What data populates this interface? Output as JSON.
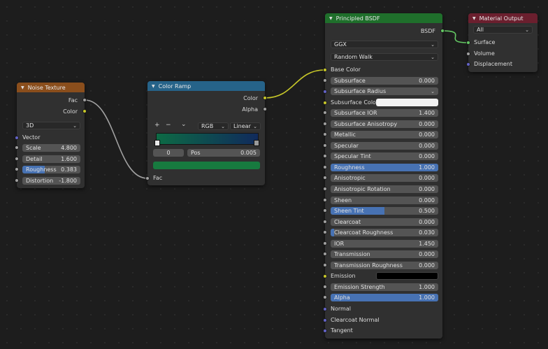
{
  "colors": {
    "noise_header": "#8a4e1c",
    "ramp_header": "#266389",
    "bsdf_header": "#1f6f2b",
    "output_header": "#6b1f2e",
    "link_gray": "#a1a1a1",
    "link_yellow": "#c7c729",
    "link_green": "#63c763",
    "slider_fill": "#4772b3"
  },
  "noise": {
    "title": "Noise Texture",
    "out_fac": "Fac",
    "out_color": "Color",
    "dimension": "3D",
    "vector": "Vector",
    "fields": [
      {
        "label": "Scale",
        "value": "4.800",
        "fill": 0
      },
      {
        "label": "Detail",
        "value": "1.600",
        "fill": 0
      },
      {
        "label": "Roughness",
        "value": "0.383",
        "fill": 0.383
      },
      {
        "label": "Distortion",
        "value": "-1.800",
        "fill": 0
      }
    ]
  },
  "ramp": {
    "title": "Color Ramp",
    "out_color": "Color",
    "out_alpha": "Alpha",
    "add": "+",
    "remove": "−",
    "menu": "⌄",
    "color_mode": "RGB",
    "interpolation": "Linear",
    "stop_index": "0",
    "pos_label": "Pos",
    "pos_value": "0.005",
    "in_fac": "Fac",
    "gradient_start": "#0d6b45",
    "gradient_end": "#102a5c",
    "active_color": "#177a3f"
  },
  "bsdf": {
    "title": "Principled BSDF",
    "out": "BSDF",
    "distribution": "GGX",
    "subsurface_method": "Random Walk",
    "base_color": "Base Color",
    "subsurface_radius": "Subsurface Radius",
    "subsurface_color": "Subsurface Color",
    "subsurface_color_value": "#f2f2f2",
    "emission": "Emission",
    "emission_value": "#000000",
    "normal": "Normal",
    "clearcoat_normal": "Clearcoat Normal",
    "tangent": "Tangent",
    "fields": [
      {
        "label": "Subsurface",
        "value": "0.000",
        "fill": 0
      },
      {
        "label": "Subsurface IOR",
        "value": "1.400",
        "fill": 0
      },
      {
        "label": "Subsurface Anisotropy",
        "value": "0.000",
        "fill": 0
      },
      {
        "label": "Metallic",
        "value": "0.000",
        "fill": 0
      },
      {
        "label": "Specular",
        "value": "0.000",
        "fill": 0
      },
      {
        "label": "Specular Tint",
        "value": "0.000",
        "fill": 0
      },
      {
        "label": "Roughness",
        "value": "1.000",
        "fill": 1
      },
      {
        "label": "Anisotropic",
        "value": "0.000",
        "fill": 0
      },
      {
        "label": "Anisotropic Rotation",
        "value": "0.000",
        "fill": 0
      },
      {
        "label": "Sheen",
        "value": "0.000",
        "fill": 0
      },
      {
        "label": "Sheen Tint",
        "value": "0.500",
        "fill": 0.5
      },
      {
        "label": "Clearcoat",
        "value": "0.000",
        "fill": 0
      },
      {
        "label": "Clearcoat Roughness",
        "value": "0.030",
        "fill": 0.03
      },
      {
        "label": "IOR",
        "value": "1.450",
        "fill": 0
      },
      {
        "label": "Transmission",
        "value": "0.000",
        "fill": 0
      },
      {
        "label": "Transmission Roughness",
        "value": "0.000",
        "fill": 0
      },
      {
        "label": "Emission Strength",
        "value": "1.000",
        "fill": 0
      },
      {
        "label": "Alpha",
        "value": "1.000",
        "fill": 1
      }
    ]
  },
  "output": {
    "title": "Material Output",
    "target": "All",
    "surface": "Surface",
    "volume": "Volume",
    "displacement": "Displacement"
  }
}
